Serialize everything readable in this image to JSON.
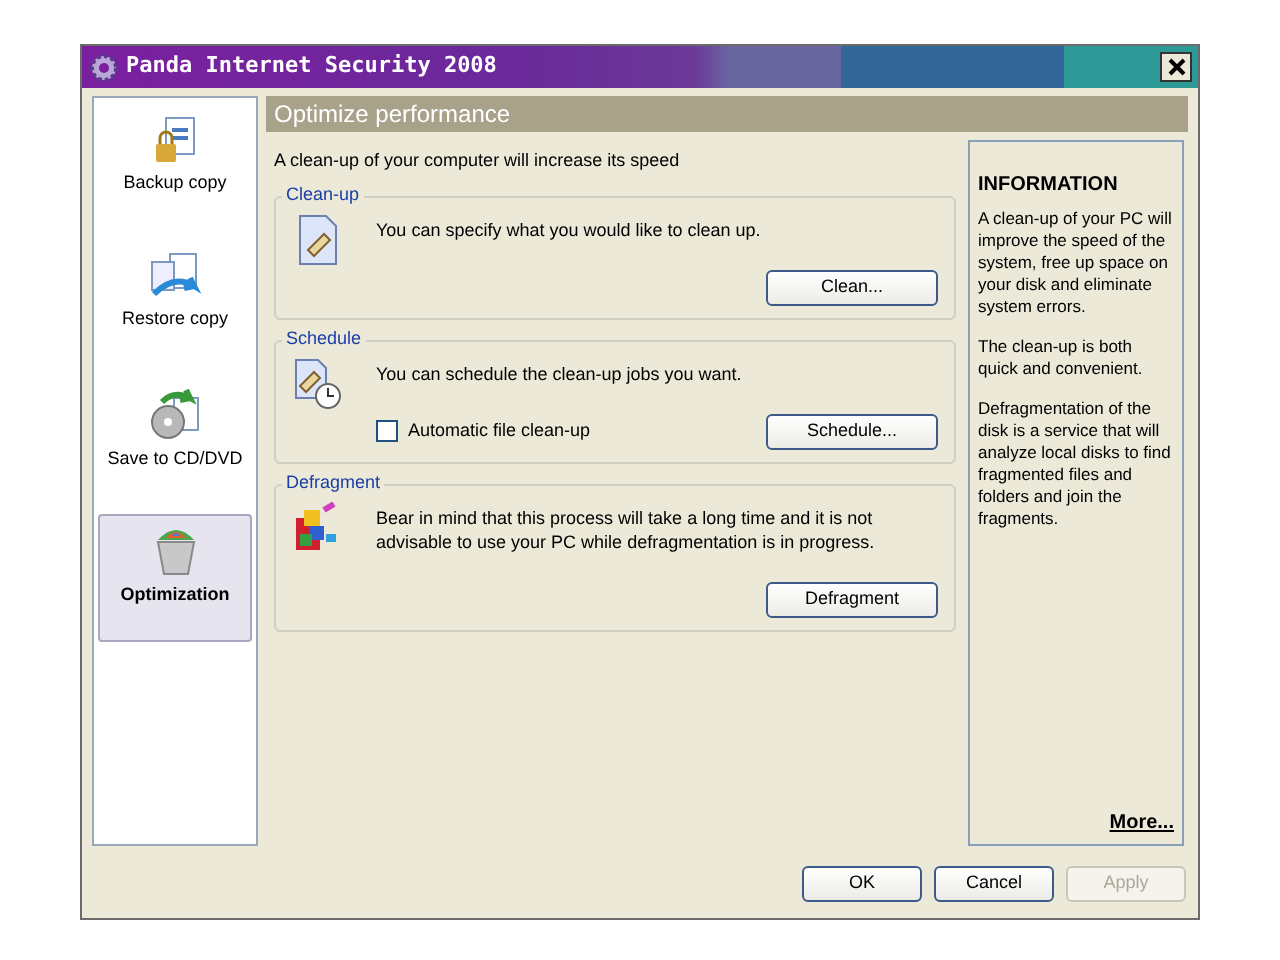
{
  "window": {
    "title": "Panda Internet Security 2008"
  },
  "sidebar": {
    "items": [
      {
        "label": "Backup copy",
        "selected": false
      },
      {
        "label": "Restore copy",
        "selected": false
      },
      {
        "label": "Save to CD/DVD",
        "selected": false
      },
      {
        "label": "Optimization",
        "selected": true
      }
    ]
  },
  "header": "Optimize performance",
  "intro": "A clean-up of your computer will increase its speed",
  "sections": [
    {
      "title": "Clean-up",
      "text": "You can specify what you would like to clean up.",
      "button": "Clean..."
    },
    {
      "title": "Schedule",
      "text": "You can schedule the clean-up jobs you want.",
      "checkbox": {
        "label": "Automatic file clean-up",
        "checked": false
      },
      "button": "Schedule..."
    },
    {
      "title": "Defragment",
      "text": "Bear in mind that this process will take a long time and it is not advisable to use your PC while defragmentation is in progress.",
      "button": "Defragment"
    }
  ],
  "info": {
    "title": "INFORMATION",
    "paragraphs": [
      "A clean-up of your PC will improve the speed of the system, free up space on your disk and eliminate system errors.",
      "The clean-up is both quick and convenient.",
      "Defragmentation of the disk is a service that will analyze local disks to find fragmented files and folders and join the fragments."
    ],
    "link": "More..."
  },
  "buttons": [
    {
      "label": "OK",
      "disabled": false
    },
    {
      "label": "Cancel",
      "disabled": false
    },
    {
      "label": "Apply",
      "disabled": true
    }
  ]
}
